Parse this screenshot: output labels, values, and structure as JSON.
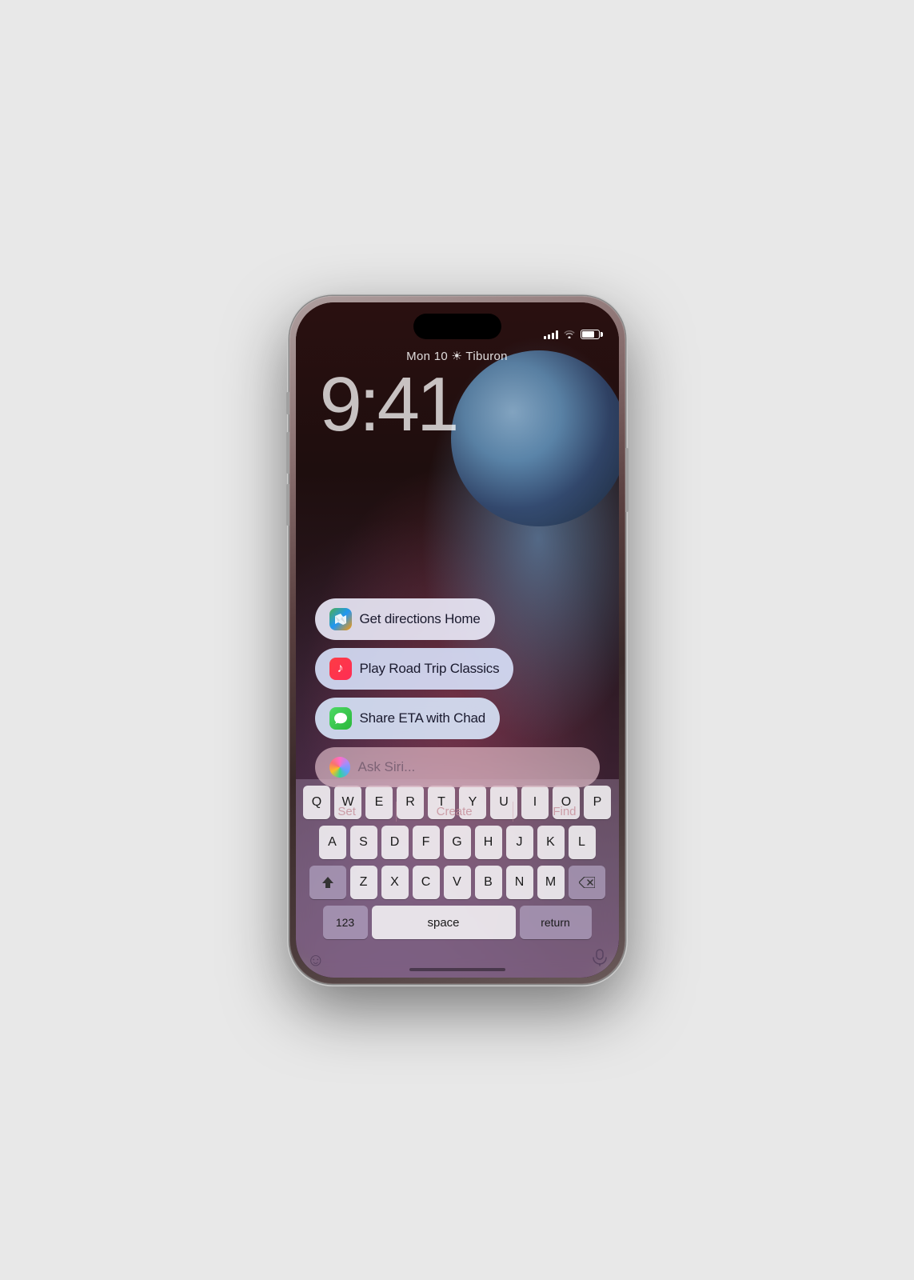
{
  "phone": {
    "status": {
      "time_display": "9:41",
      "date_weather": "Mon 10  ☀  Tiburon"
    },
    "suggestions": [
      {
        "id": "maps",
        "icon_type": "maps-icon",
        "icon_label": "maps-icon",
        "text": "Get directions Home"
      },
      {
        "id": "music",
        "icon_type": "music-icon",
        "icon_label": "music-icon",
        "text": "Play Road Trip Classics"
      },
      {
        "id": "messages",
        "icon_type": "messages-icon",
        "icon_label": "messages-icon",
        "text": "Share ETA with Chad"
      }
    ],
    "siri": {
      "placeholder": "Ask Siri..."
    },
    "quick_actions": [
      "Set",
      "Create",
      "Find"
    ],
    "keyboard": {
      "row1": [
        "Q",
        "W",
        "E",
        "R",
        "T",
        "Y",
        "U",
        "I",
        "O",
        "P"
      ],
      "row2": [
        "A",
        "S",
        "D",
        "F",
        "G",
        "H",
        "J",
        "K",
        "L"
      ],
      "row3": [
        "Z",
        "X",
        "C",
        "V",
        "B",
        "N",
        "M"
      ],
      "bottom": {
        "nums": "123",
        "space": "space",
        "return": "return"
      }
    }
  }
}
